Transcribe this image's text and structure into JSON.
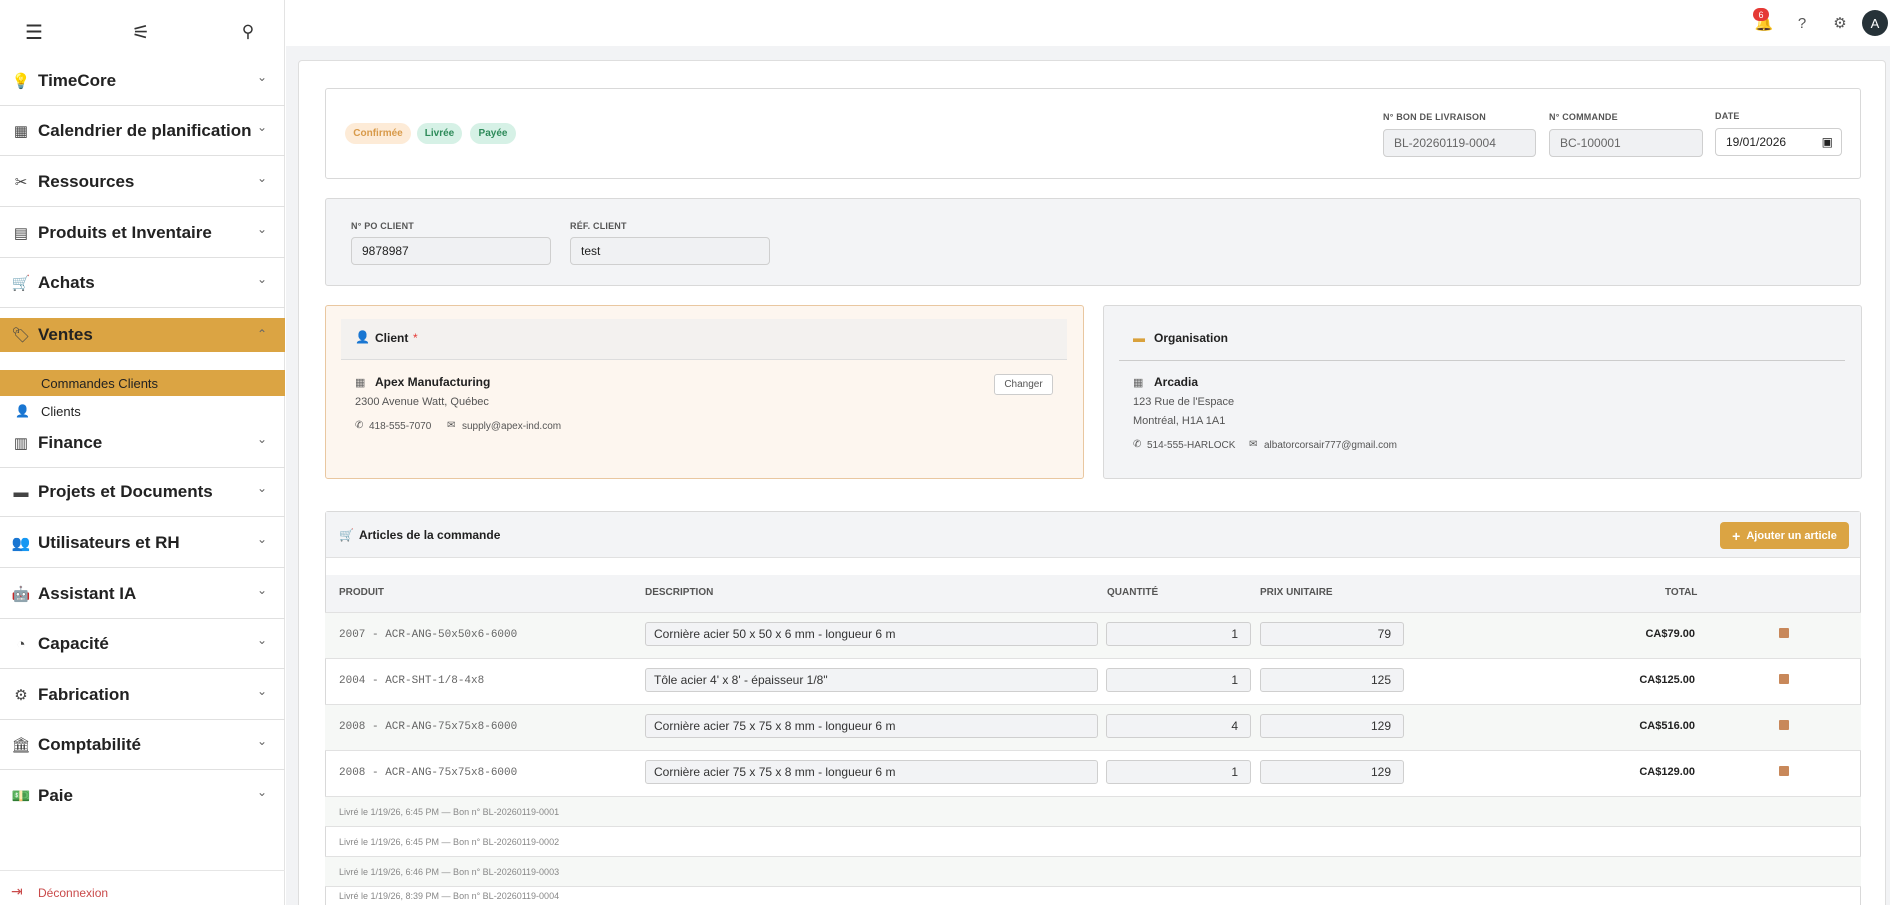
{
  "sidebar": {
    "top_icons": [
      "menu-icon",
      "tune-icon",
      "search-icon"
    ],
    "items": [
      {
        "label": "TimeCore",
        "icon": "lightbulb-icon"
      },
      {
        "label": "Calendrier de planification",
        "icon": "calendar-icon"
      },
      {
        "label": "Ressources",
        "icon": "tools-icon"
      },
      {
        "label": "Produits et Inventaire",
        "icon": "inventory-icon"
      },
      {
        "label": "Achats",
        "icon": "cart-icon"
      },
      {
        "label": "Ventes",
        "icon": "tag-icon"
      },
      {
        "label": "Finance",
        "icon": "receipt-icon"
      },
      {
        "label": "Projets et Documents",
        "icon": "folder-icon"
      },
      {
        "label": "Utilisateurs et RH",
        "icon": "group-icon"
      },
      {
        "label": "Assistant IA",
        "icon": "robot-icon"
      },
      {
        "label": "Capacité",
        "icon": "gauge-icon"
      },
      {
        "label": "Fabrication",
        "icon": "robot-arm-icon"
      },
      {
        "label": "Comptabilité",
        "icon": "bank-icon"
      },
      {
        "label": "Paie",
        "icon": "payments-icon"
      }
    ],
    "sub_items": [
      {
        "label": "Commandes Clients"
      },
      {
        "label": "Clients"
      }
    ],
    "logout": "Déconnexion"
  },
  "topbar": {
    "notification_count": "6",
    "avatar_initial": "A"
  },
  "status": {
    "pills": [
      {
        "label": "Confirmée",
        "bg": "#fdebd7",
        "fg": "#d89a4a"
      },
      {
        "label": "Livrée",
        "bg": "#d6f1e6",
        "fg": "#2e8b5a"
      },
      {
        "label": "Payée",
        "bg": "#d6f1e6",
        "fg": "#2e8b5a"
      }
    ]
  },
  "header_fields": {
    "delivery_label": "N° BON DE LIVRAISON",
    "delivery_value": "BL-20260119-0004",
    "order_label": "N° COMMANDE",
    "order_value": "BC-100001",
    "date_label": "DATE",
    "date_value": "19/01/2026"
  },
  "client_refs": {
    "po_label": "N° PO CLIENT",
    "po_value": "9878987",
    "ref_label": "RÉF. CLIENT",
    "ref_value": "test"
  },
  "client": {
    "title": "Client",
    "required": "*",
    "name": "Apex Manufacturing",
    "address": "2300 Avenue Watt, Québec",
    "phone": "418-555-7070",
    "email": "supply@apex-ind.com",
    "change_label": "Changer"
  },
  "organisation": {
    "title": "Organisation",
    "name": "Arcadia",
    "address1": "123 Rue de l'Espace",
    "address2": "Montréal, H1A 1A1",
    "phone": "514-555-HARLOCK",
    "email": "albatorcorsair777@gmail.com"
  },
  "articles": {
    "title": "Articles de la commande",
    "add_label": "Ajouter un article",
    "headers": [
      "PRODUIT",
      "DESCRIPTION",
      "QUANTITÉ",
      "PRIX UNITAIRE",
      "TOTAL"
    ],
    "rows": [
      {
        "product": "2007 - ACR-ANG-50x50x6-6000",
        "description": "Cornière acier 50 x 50 x 6 mm - longueur 6 m",
        "qty": "1",
        "price": "79",
        "total": "CA$79.00"
      },
      {
        "product": "2004 - ACR-SHT-1/8-4x8",
        "description": "Tôle acier 4' x 8' - épaisseur 1/8\"",
        "qty": "1",
        "price": "125",
        "total": "CA$125.00"
      },
      {
        "product": "2008 - ACR-ANG-75x75x8-6000",
        "description": "Cornière acier 75 x 75 x 8 mm - longueur 6 m",
        "qty": "4",
        "price": "129",
        "total": "CA$516.00"
      },
      {
        "product": "2008 - ACR-ANG-75x75x8-6000",
        "description": "Cornière acier 75 x 75 x 8 mm - longueur 6 m",
        "qty": "1",
        "price": "129",
        "total": "CA$129.00"
      }
    ],
    "history": [
      "Livré le 1/19/26, 6:45 PM — Bon n° BL-20260119-0001",
      "Livré le 1/19/26, 6:45 PM — Bon n° BL-20260119-0002",
      "Livré le 1/19/26, 6:46 PM — Bon n° BL-20260119-0003",
      "Livré le 1/19/26, 8:39 PM — Bon n° BL-20260119-0004"
    ]
  },
  "colors": {
    "accent": "#dba443",
    "client_bg": "#fdf6ef",
    "client_border": "#e9c7a0"
  }
}
